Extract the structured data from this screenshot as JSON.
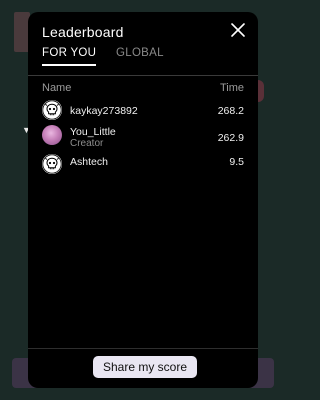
{
  "modal": {
    "title": "Leaderboard",
    "close_icon": "close-icon"
  },
  "tabs": [
    {
      "label": "FOR YOU",
      "active": true
    },
    {
      "label": "GLOBAL",
      "active": false
    }
  ],
  "table": {
    "columns": [
      "Name",
      "Time"
    ],
    "rows": [
      {
        "name": "kaykay273892",
        "subtitle": "",
        "time": "268.2",
        "avatar": "skull-avatar-icon"
      },
      {
        "name": "You_Little",
        "subtitle": "Creator",
        "time": "262.9",
        "avatar": "profile-photo"
      },
      {
        "name": "Ashtech",
        "subtitle": "",
        "time": "9.5",
        "avatar": "skull-avatar-icon"
      }
    ]
  },
  "footer": {
    "share_label": "Share my score"
  },
  "colors": {
    "modal_bg": "#000000",
    "page_bg": "#1b2a27",
    "button_bg": "#e9e6f2"
  }
}
